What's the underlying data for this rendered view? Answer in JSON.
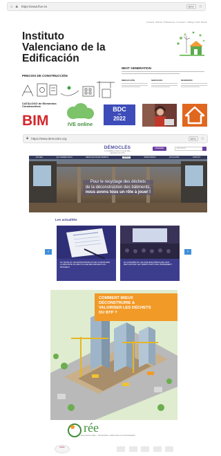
{
  "ive": {
    "browser_url": "https://www.five.es",
    "browser_zoom": "80%",
    "top_nav": [
      "Contacta",
      "Noticias",
      "Publicaciones",
      "Formación",
      "Catálogo",
      "Perfil",
      "Buscar"
    ],
    "title": "Instituto Valenciano de la Edificación",
    "precios_label": "PRECIOS DE CONSTRUCCIÓN",
    "next_generation": "NEXT GENERATION",
    "next_gen_cols": [
      "INNOVACIÓN",
      "SERVICIOS",
      "INVERSIÓN"
    ],
    "catalogo_label": "CATÁLOGO de Elementos Constructivos",
    "bim_logo_text": "BIM",
    "ive_online_text": "IVE online",
    "bdc": {
      "line1": "BDC",
      "line2": "IVE",
      "line3": "2022"
    }
  },
  "democles": {
    "browser_url": "https://www.democles.org",
    "browser_zoom": "80%",
    "logo": "DÉMOCLÈS",
    "tagline": "LA FILIÈRE DU RECYCLAGE DES DÉCHETS DU BTP",
    "nav_items": [
      "ACCUEIL",
      "QUI SOMMES-NOUS",
      "DEMOCLES MODE D'EMPLOI",
      "OUTILS",
      "RESSOURCES",
      "ACTUALITÉS",
      "CONTACT"
    ],
    "active_nav_index": 3,
    "cta_label": "ADHÉRER",
    "search_placeholder": "Rechercher",
    "hero_lines": [
      "Pour le recyclage des déchets",
      "de la déconstruction des bâtiments,",
      "nous avons tous un rôle à jouer !"
    ],
    "news_heading": "Les actualités",
    "news_cards": [
      {
        "caption": "LE TEXTE ET LES RESSOURCES POUR CONSTRUIRE LA RÉUSSITE DU RECYCLAGE DES DÉCHETS DU BÂTIMENT"
      },
      {
        "caption": "LE CONGRÈS ET LES ATELIERS DÉMOCLÈS 2022 : RETOUR SUR LES TEMPS FORTS DE L'ÉVÉNEMENT"
      }
    ],
    "arrow_prev": "‹",
    "arrow_next": "›"
  },
  "brochure": {
    "title_lines": [
      "COMMENT MIEUX",
      "DÉCONSTRUIRE &",
      "VALORISER LES DÉCHETS",
      "DU BTP ?"
    ],
    "logo": "rée",
    "logo_tagline": "ASSOCIATION ORÉE — ENTREPRISES, TERRITOIRES ET ENVIRONNEMENT",
    "partner": "ba&do"
  },
  "colors": {
    "bdc_blue": "#3d4cb8",
    "democles_purple": "#6a3fa0",
    "news_caption_bg": "#3d3d8e",
    "slider_arrow": "#3f8fd9",
    "brochure_orange": "#f29a27",
    "oree_green": "#3f8e3a",
    "house_tile_orange": "#e0671f"
  }
}
